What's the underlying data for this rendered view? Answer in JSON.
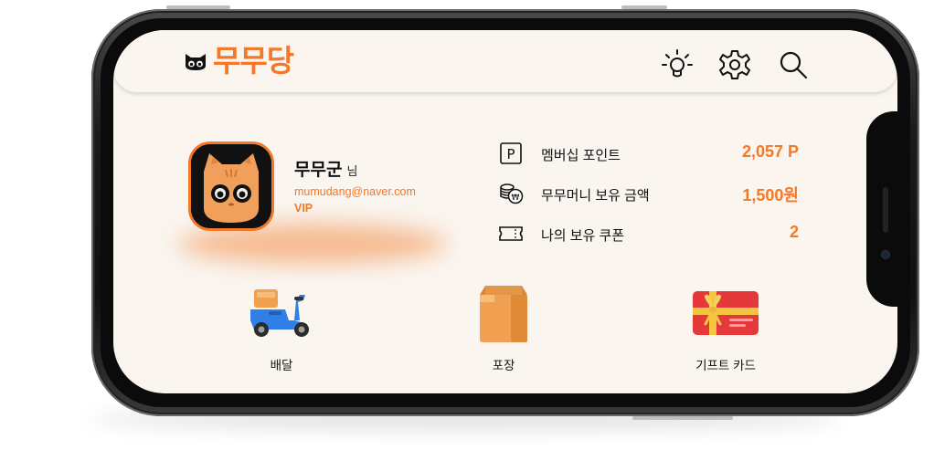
{
  "brand": {
    "name": "무무당"
  },
  "header_icons": [
    "lightbulb-icon",
    "gear-icon",
    "search-icon"
  ],
  "user": {
    "name": "무무군",
    "name_suffix": "님",
    "email": "mumudang@naver.com",
    "level": "VIP"
  },
  "stats": [
    {
      "icon": "parking-p-icon",
      "label": "멤버십 포인트",
      "value": "2,057 P"
    },
    {
      "icon": "coins-icon",
      "label": "무무머니 보유 금액",
      "value": "1,500원"
    },
    {
      "icon": "ticket-icon",
      "label": "나의 보유 쿠폰",
      "value": "2"
    }
  ],
  "services": [
    {
      "icon": "scooter-icon",
      "label": "배달"
    },
    {
      "icon": "paper-bag-icon",
      "label": "포장"
    },
    {
      "icon": "gift-card-icon",
      "label": "기프트 카드"
    }
  ],
  "colors": {
    "accent": "#f3782a",
    "screen_bg": "#faf5ef",
    "text": "#111111"
  }
}
